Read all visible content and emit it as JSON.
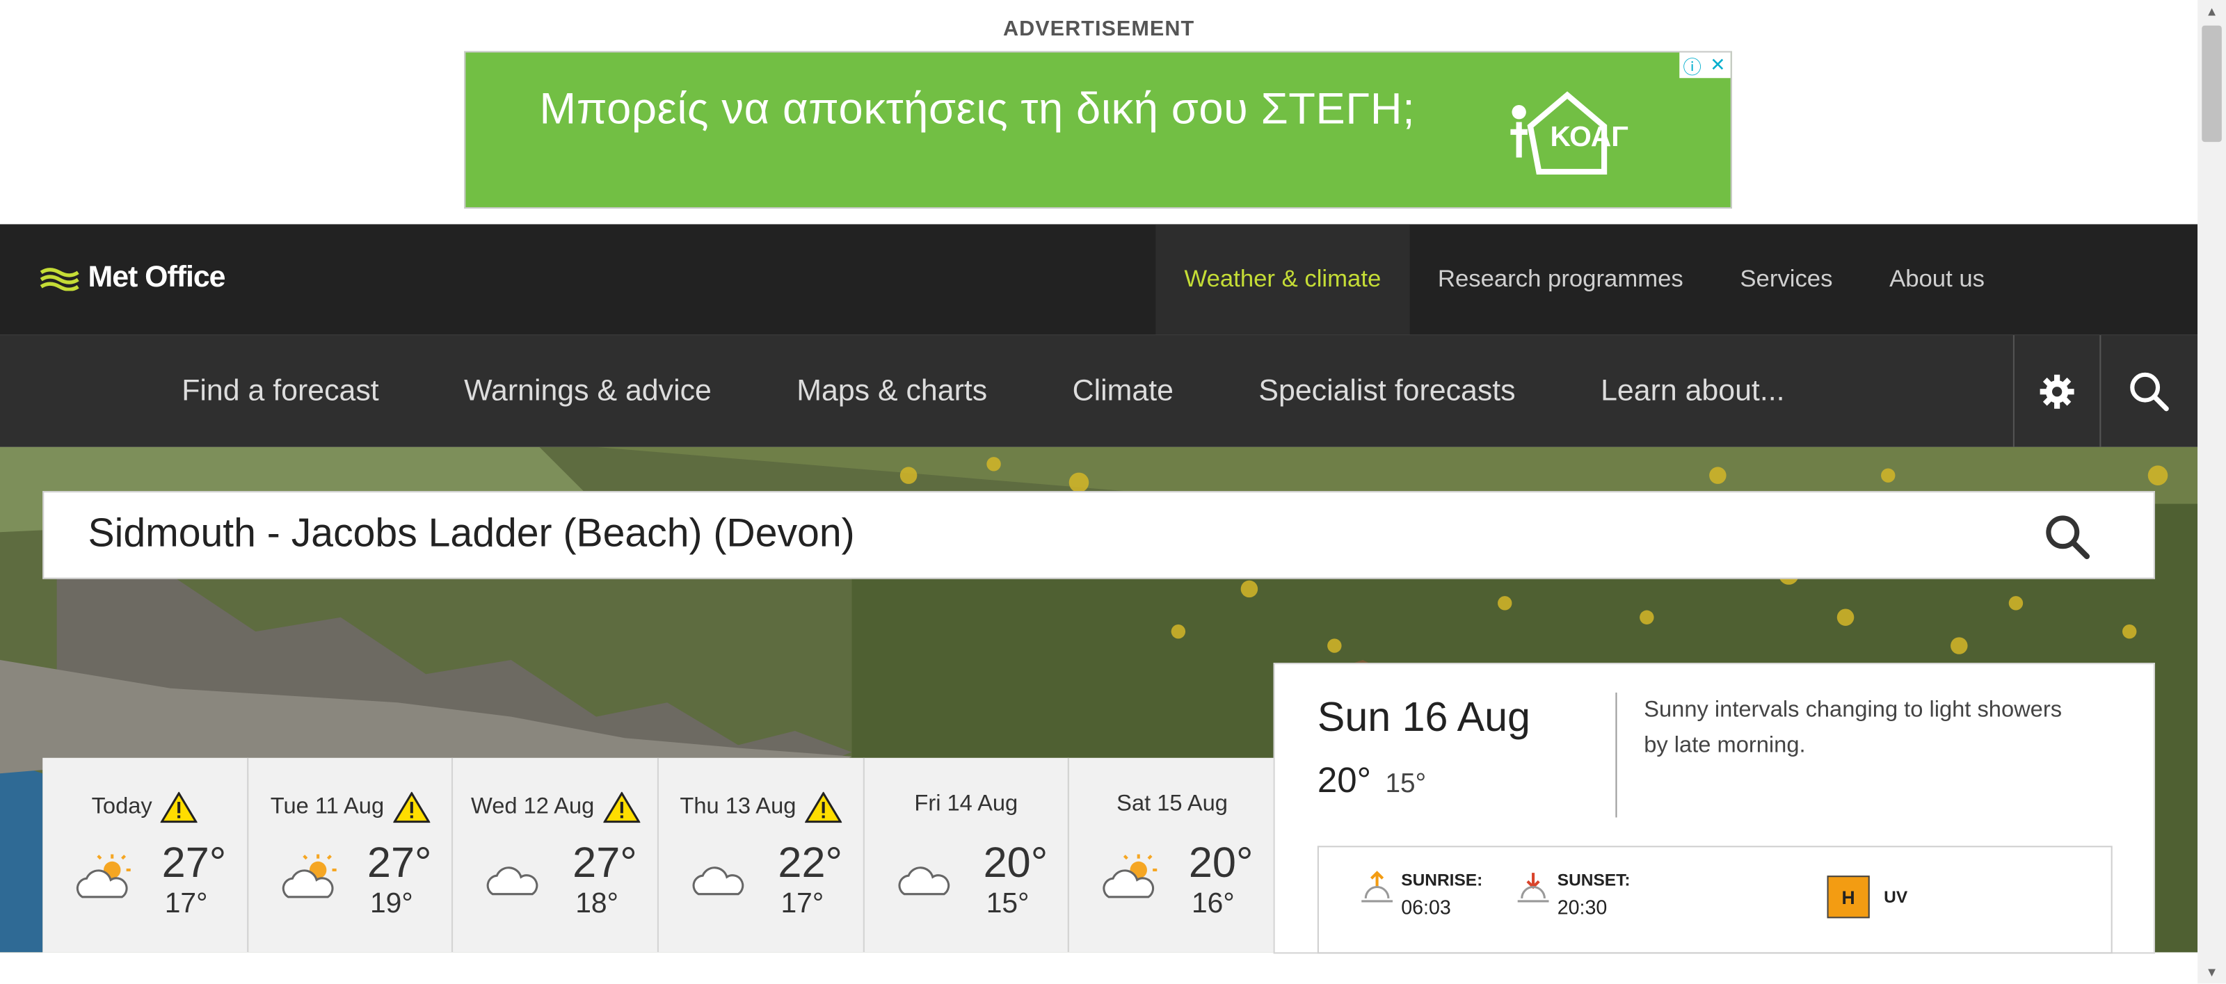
{
  "ad": {
    "label": "ADVERTISEMENT",
    "text": "Μπορείς να αποκτήσεις τη δική σου ΣΤΕΓΗ;",
    "logo_text": "ΚΟΑΓ",
    "info_icon": "info-icon",
    "close_icon": "close-icon",
    "color": "#72bf44"
  },
  "header": {
    "brand": "Met Office",
    "nav": [
      {
        "label": "Weather & climate",
        "active": true
      },
      {
        "label": "Research programmes",
        "active": false
      },
      {
        "label": "Services",
        "active": false
      },
      {
        "label": "About us",
        "active": false
      }
    ],
    "accent_color": "#c5dd36"
  },
  "subnav": {
    "links": [
      "Find a forecast",
      "Warnings & advice",
      "Maps & charts",
      "Climate",
      "Specialist forecasts",
      "Learn about..."
    ],
    "settings_icon": "gear-icon",
    "search_icon": "search-icon"
  },
  "search": {
    "value": "Sidmouth - Jacobs Ladder (Beach) (Devon)"
  },
  "forecast": {
    "days": [
      {
        "day": "Today",
        "warning": true,
        "icon": "sunny-intervals-icon",
        "high": "27°",
        "low": "17°"
      },
      {
        "day": "Tue 11 Aug",
        "warning": true,
        "icon": "sunny-intervals-icon",
        "high": "27°",
        "low": "19°"
      },
      {
        "day": "Wed 12 Aug",
        "warning": true,
        "icon": "cloudy-icon",
        "high": "27°",
        "low": "18°"
      },
      {
        "day": "Thu 13 Aug",
        "warning": true,
        "icon": "cloudy-icon",
        "high": "22°",
        "low": "17°"
      },
      {
        "day": "Fri 14 Aug",
        "warning": false,
        "icon": "cloudy-icon",
        "high": "20°",
        "low": "15°"
      },
      {
        "day": "Sat 15 Aug",
        "warning": false,
        "icon": "sunny-intervals-icon",
        "high": "20°",
        "low": "16°"
      }
    ]
  },
  "detail": {
    "date": "Sun 16 Aug",
    "high": "20°",
    "low": "15°",
    "summary": "Sunny intervals changing to light showers by late morning.",
    "sunrise_label": "SUNRISE:",
    "sunrise": "06:03",
    "sunset_label": "SUNSET:",
    "sunset": "20:30",
    "uv_level": "H",
    "uv_label": "UV",
    "uv_color": "#f39c12"
  }
}
